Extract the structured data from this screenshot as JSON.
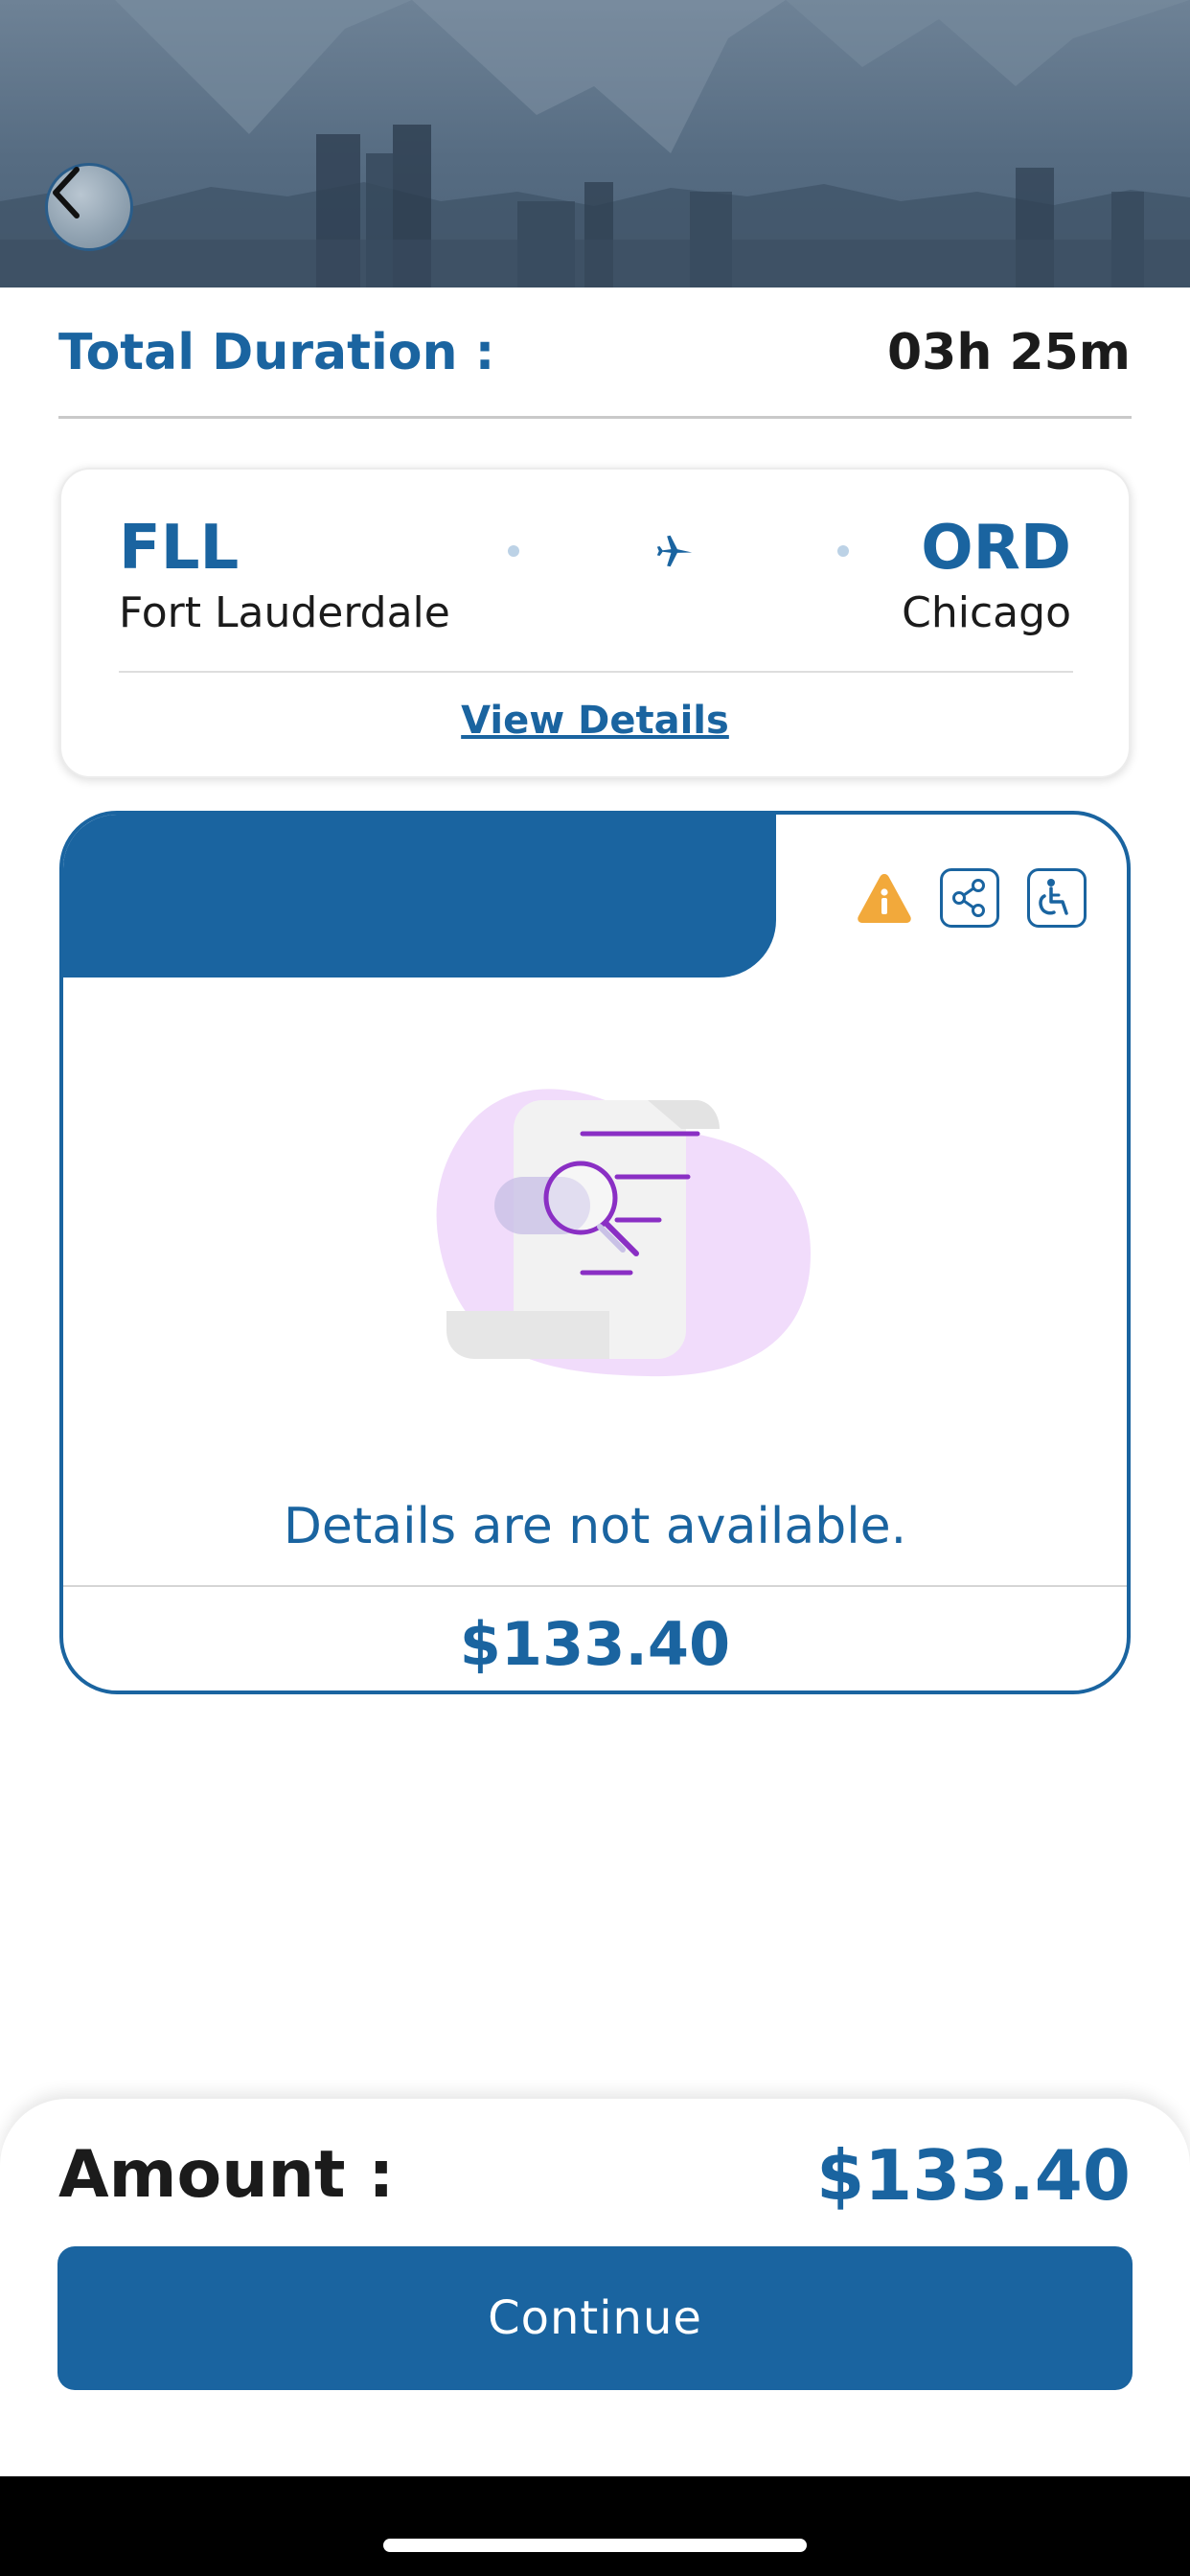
{
  "header": {
    "back_icon": "chevron-left-icon"
  },
  "duration": {
    "label": "Total Duration :",
    "value": "03h 25m"
  },
  "route": {
    "from_code": "FLL",
    "from_city": "Fort Lauderdale",
    "to_code": "ORD",
    "to_city": "Chicago",
    "plane_icon": "airplane-icon",
    "view_details_label": "View Details"
  },
  "fare_card": {
    "action_icons": [
      "warning-icon",
      "share-icon",
      "wheelchair-accessible-icon"
    ],
    "empty_message": "Details are not available.",
    "price": "$133.40"
  },
  "footer": {
    "amount_label": "Amount :",
    "amount_value": "$133.40",
    "continue_label": "Continue"
  },
  "colors": {
    "primary": "#1a64a0",
    "warning": "#f2a93b",
    "illustration_accent": "#8a2fc4",
    "illustration_blob": "#f1dcfb"
  }
}
